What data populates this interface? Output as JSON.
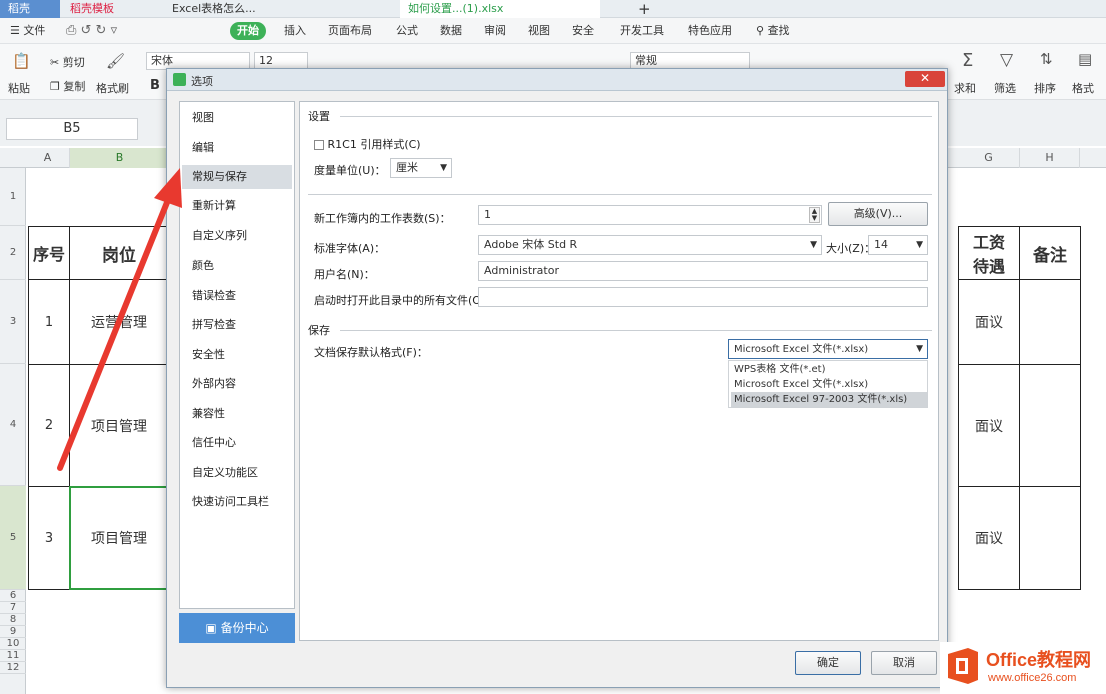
{
  "tabs": {
    "home": "稻壳",
    "docer": "稻壳模板",
    "doc1": "Excel表格怎么...",
    "doc2": "如何设置...(1).xlsx"
  },
  "menu": {
    "file": "文件",
    "start": "开始",
    "insert": "插入",
    "layout": "页面布局",
    "formula": "公式",
    "data": "数据",
    "review": "审阅",
    "view": "视图",
    "security": "安全",
    "dev": "开发工具",
    "special": "特色应用",
    "search": "查找"
  },
  "toolbar": {
    "paste": "粘贴",
    "cut": "剪切",
    "copy": "复制",
    "format_painter": "格式刷",
    "font": "宋体",
    "size": "12",
    "bold": "B",
    "num_format": "常规",
    "sum": "求和",
    "filter": "筛选",
    "sort": "排序",
    "format": "格式"
  },
  "namebox": "B5",
  "columns": [
    "A",
    "B",
    "G",
    "H"
  ],
  "rows": [
    "1",
    "2",
    "3",
    "4",
    "5",
    "6",
    "7",
    "8",
    "9",
    "10",
    "11",
    "12"
  ],
  "sheet": {
    "h_seq": "序号",
    "h_post": "岗位",
    "h_pay": "工资待遇",
    "h_note": "备注",
    "r1_seq": "1",
    "r1_post": "运营管理",
    "r1_pay": "面议",
    "r2_seq": "2",
    "r2_post": "项目管理",
    "r2_pay": "面议",
    "r3_seq": "3",
    "r3_post": "项目管理",
    "r3_pay": "面议"
  },
  "dialog": {
    "title": "选项",
    "nav": [
      "视图",
      "编辑",
      "常规与保存",
      "重新计算",
      "自定义序列",
      "颜色",
      "错误检查",
      "拼写检查",
      "安全性",
      "外部内容",
      "兼容性",
      "信任中心",
      "自定义功能区",
      "快速访问工具栏"
    ],
    "selected_nav": "常规与保存",
    "backup": "备份中心",
    "settings_title": "设置",
    "r1c1": "R1C1 引用样式(C)",
    "unit_label": "度量单位(U)：",
    "unit_value": "厘米",
    "sheets_label": "新工作簿内的工作表数(S)：",
    "sheets_value": "1",
    "advanced_button": "高级(V)...",
    "font_label": "标准字体(A)：",
    "font_value": "Adobe 宋体 Std R",
    "size_label": "大小(Z)：",
    "size_value": "14",
    "username_label": "用户名(N)：",
    "username_value": "Administrator",
    "startup_label": "启动时打开此目录中的所有文件(O)：",
    "save_title": "保存",
    "saveformat_label": "文档保存默认格式(F)：",
    "saveformat_value": "Microsoft Excel 文件(*.xlsx)",
    "dropdown_options": [
      "WPS表格 文件(*.et)",
      "Microsoft Excel 文件(*.xlsx)",
      "Microsoft Excel 97-2003 文件(*.xls)"
    ],
    "ok": "确定",
    "cancel": "取消"
  },
  "watermark": {
    "brand": "Office教程网",
    "url": "www.office26.com"
  },
  "colors": {
    "accent": "#3db158",
    "arrow": "#e8392f",
    "logo": "#e8501f"
  }
}
